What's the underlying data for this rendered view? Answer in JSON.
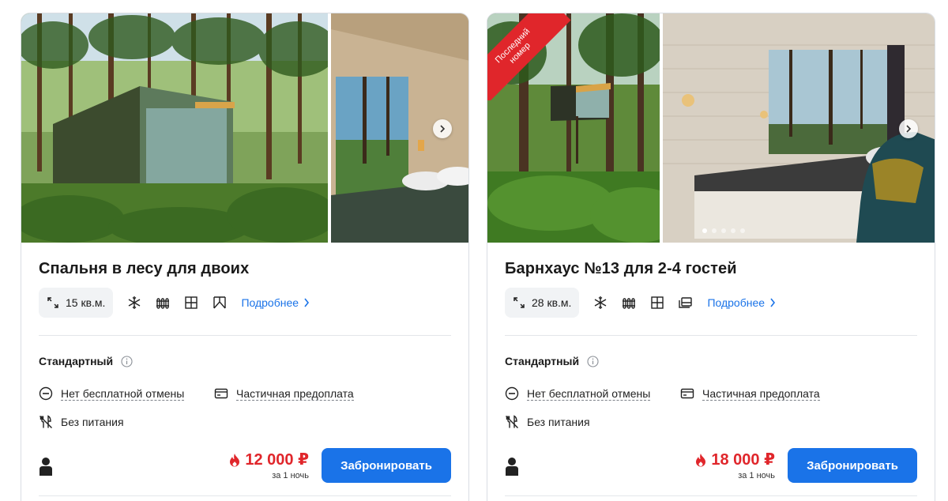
{
  "rooms": [
    {
      "title": "Спальня в лесу для двоих",
      "area": "15 кв.м.",
      "amenities": [
        "snowflake-icon",
        "radiator-icon",
        "wardrobe-icon",
        "window-icon"
      ],
      "details_link": "Подробнее",
      "tariff": "Стандартный",
      "cancellation": "Нет бесплатной отмены",
      "prepayment": "Частичная предоплата",
      "meals": "Без питания",
      "guests": 1,
      "price": "12 000 ₽",
      "price_note": "за 1 ночь",
      "book_label": "Забронировать",
      "badge": ""
    },
    {
      "title": "Барнхаус №13 для 2-4 гостей",
      "area": "28 кв.м.",
      "amenities": [
        "snowflake-icon",
        "radiator-icon",
        "wardrobe-icon",
        "sofa-bed-icon"
      ],
      "details_link": "Подробнее",
      "tariff": "Стандартный",
      "cancellation": "Нет бесплатной отмены",
      "prepayment": "Частичная предоплата",
      "meals": "Без питания",
      "guests": 1,
      "price": "18 000 ₽",
      "price_note": "за 1 ночь",
      "book_label": "Забронировать",
      "badge": "Последний номер"
    }
  ],
  "colors": {
    "accent": "#1a73e8",
    "price": "#e0262b",
    "badge": "#e0262b"
  }
}
